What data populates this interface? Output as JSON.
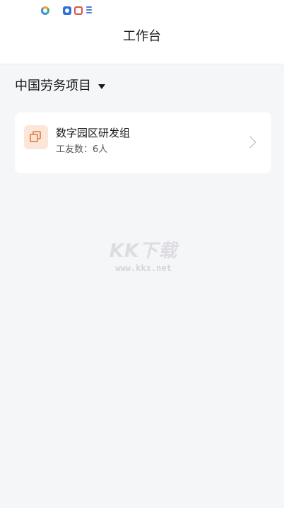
{
  "status_bar": {
    "icons": [
      "app-circle-icon",
      "app-shield-icon",
      "app-square-icon",
      "app-stack-icon"
    ]
  },
  "header": {
    "title": "工作台"
  },
  "project": {
    "name": "中国劳务项目"
  },
  "card": {
    "title": "数字园区研发组",
    "workers_label": "工友数：",
    "workers_value": "6人"
  },
  "watermark": {
    "main": "KK下载",
    "url": "www.kkx.net"
  },
  "colors": {
    "background": "#f5f6f8",
    "card": "#ffffff",
    "icon_bg": "#fbe6d9",
    "icon_accent": "#e4915e"
  }
}
